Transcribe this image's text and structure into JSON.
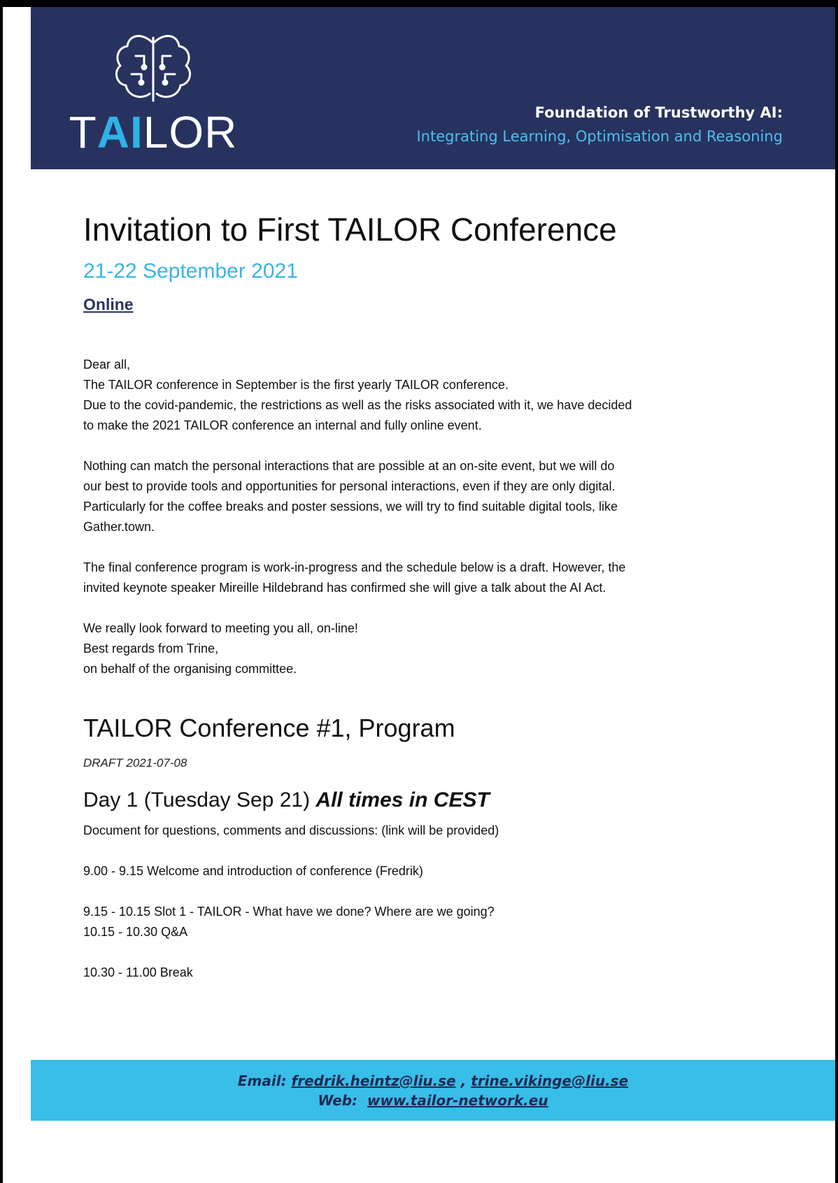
{
  "header": {
    "logo_prefix": "T",
    "logo_ai": "AI",
    "logo_suffix": "LOR",
    "tagline_line1": "Foundation of Trustworthy AI:",
    "tagline_line2": "Integrating Learning, Optimisation and Reasoning",
    "colors": {
      "navy": "#27325f",
      "accent": "#2fb2e6"
    }
  },
  "document": {
    "title": "Invitation to First TAILOR Conference",
    "date": "21-22 September 2021",
    "venue": "Online",
    "para1": [
      "Dear all,",
      "The TAILOR conference in September is the first yearly TAILOR conference.",
      "Due to the covid-pandemic, the restrictions as well as the risks associated with it, we have decided",
      "to make the 2021 TAILOR conference an internal and fully online event."
    ],
    "para2": [
      "Nothing can match the personal interactions that are possible at an on-site event, but we will do",
      "our best to provide tools and opportunities for personal interactions, even if they are only digital.",
      "Particularly for the coffee breaks and poster sessions, we will try to find suitable digital tools, like",
      "Gather.town."
    ],
    "para3": [
      "The final conference program is work-in-progress and the schedule below is a draft. However, the",
      "invited keynote speaker Mireille Hildebrand has confirmed she will give a talk about the AI Act."
    ],
    "para4": [
      "We really look forward to meeting you all, on-line!",
      "Best regards from Trine,",
      "on behalf of the organising committee."
    ]
  },
  "program": {
    "heading": "TAILOR Conference #1, Program",
    "draft": "DRAFT 2021-07-08",
    "day1_heading": "Day 1 (Tuesday Sep 21)",
    "day1_note": "All times in CEST",
    "doc_link": "Document for questions, comments and discussions: (link will be provided)",
    "item1": "9.00 - 9.15 Welcome and introduction of conference (Fredrik)",
    "item2a": "9.15 - 10.15 Slot 1 - TAILOR - What have we done? Where are we going?",
    "item2b": "10.15 - 10.30 Q&A",
    "item3": "10.30 - 11.00 Break"
  },
  "footer": {
    "email_label": "Email:",
    "email1": "fredrik.heintz@liu.se",
    "email_sep": " , ",
    "email2": "trine.vikinge@liu.se",
    "web_label": "Web:",
    "web": "www.tailor-network.eu",
    "color": "#39bde9"
  }
}
